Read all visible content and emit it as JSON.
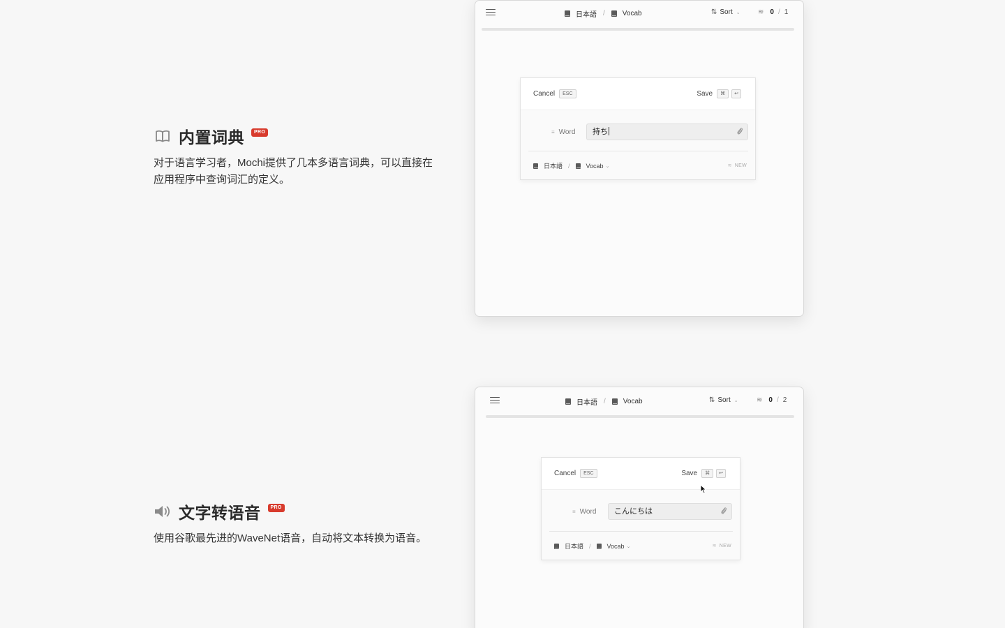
{
  "features": [
    {
      "icon": "book-open-icon",
      "title": "内置词典",
      "badge": "PRO",
      "description": "对于语言学习者，Mochi提供了几本多语言词典，可以直接在应用程序中查询词汇的定义。"
    },
    {
      "icon": "speaker-icon",
      "title": "文字转语音",
      "badge": "PRO",
      "description": "使用谷歌最先进的WaveNet语音，自动将文本转换为语音。"
    }
  ],
  "windows": [
    {
      "deck": "日本語",
      "subdeck": "Vocab",
      "sort_label": "Sort",
      "count_current": "0",
      "count_total": "1",
      "editor": {
        "cancel_label": "Cancel",
        "cancel_key": "ESC",
        "save_label": "Save",
        "save_key1": "⌘",
        "save_key2": "↩",
        "field_label": "Word",
        "field_value": "持ち",
        "footer_deck": "日本語",
        "footer_subdeck": "Vocab",
        "status": "NEW"
      }
    },
    {
      "deck": "日本語",
      "subdeck": "Vocab",
      "sort_label": "Sort",
      "count_current": "0",
      "count_total": "2",
      "editor": {
        "cancel_label": "Cancel",
        "cancel_key": "ESC",
        "save_label": "Save",
        "save_key1": "⌘",
        "save_key2": "↩",
        "field_label": "Word",
        "field_value": "こんにちは",
        "footer_deck": "日本語",
        "footer_subdeck": "Vocab",
        "status": "NEW"
      }
    }
  ]
}
